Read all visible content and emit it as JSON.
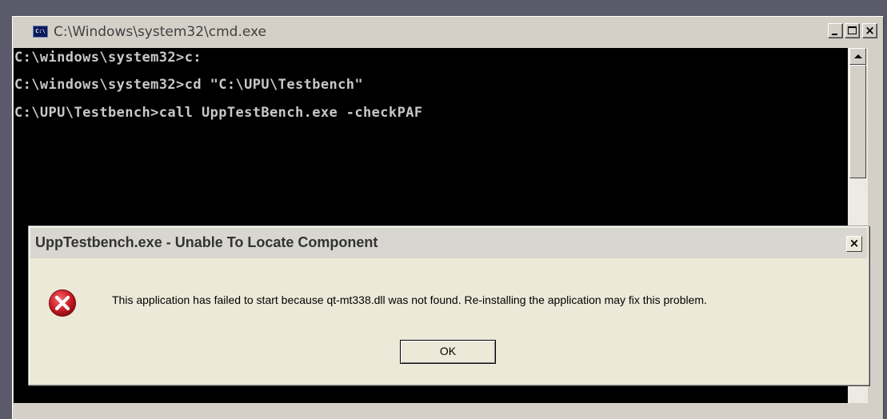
{
  "cmd_window": {
    "title": "C:\\Windows\\system32\\cmd.exe",
    "icon_label": "C:\\",
    "controls": {
      "minimize": "_",
      "maximize": "□",
      "close": "×"
    },
    "lines": [
      "C:\\windows\\system32>c:",
      "C:\\windows\\system32>cd \"C:\\UPU\\Testbench\"",
      "C:\\UPU\\Testbench>call UppTestBench.exe -checkPAF"
    ]
  },
  "dialog": {
    "title": "UppTestbench.exe - Unable To Locate Component",
    "close_label": "×",
    "message": "This application has failed to start because qt-mt338.dll was not found. Re-installing the application may fix this problem.",
    "ok_label": "OK"
  },
  "colors": {
    "console_bg": "#000000",
    "console_text": "#c8c8c8",
    "error_red": "#d0202a"
  }
}
